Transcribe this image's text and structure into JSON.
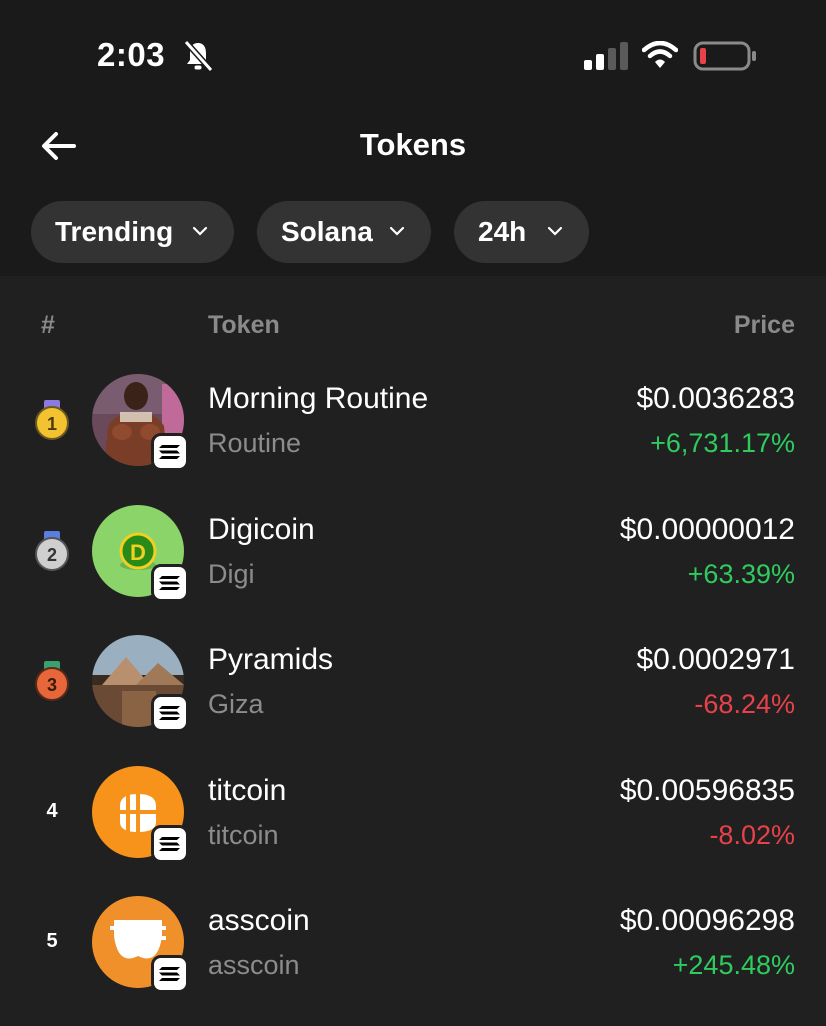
{
  "status_bar": {
    "time": "2:03"
  },
  "header": {
    "title": "Tokens"
  },
  "filters": [
    {
      "label": "Trending"
    },
    {
      "label": "Solana"
    },
    {
      "label": "24h"
    }
  ],
  "table": {
    "columns": {
      "rank": "#",
      "token": "Token",
      "price": "Price"
    },
    "rows": [
      {
        "rank": "1",
        "name": "Morning Routine",
        "symbol": "Routine",
        "price": "$0.0036283",
        "change": "+6,731.17%",
        "direction": "up",
        "avatar": "man-photo"
      },
      {
        "rank": "2",
        "name": "Digicoin",
        "symbol": "Digi",
        "price": "$0.00000012",
        "change": "+63.39%",
        "direction": "up",
        "avatar": "green-coin"
      },
      {
        "rank": "3",
        "name": "Pyramids",
        "symbol": "Giza",
        "price": "$0.0002971",
        "change": "-68.24%",
        "direction": "down",
        "avatar": "pyramids-photo"
      },
      {
        "rank": "4",
        "name": "titcoin",
        "symbol": "titcoin",
        "price": "$0.00596835",
        "change": "-8.02%",
        "direction": "down",
        "avatar": "orange-b-coin"
      },
      {
        "rank": "5",
        "name": "asscoin",
        "symbol": "asscoin",
        "price": "$0.00096298",
        "change": "+245.48%",
        "direction": "up",
        "avatar": "orange-underwear-coin"
      }
    ]
  },
  "colors": {
    "positive": "#2ecc5f",
    "negative": "#e8414a",
    "gold": "#f2c230",
    "silver": "#cfcfcf",
    "bronze": "#e8673a"
  }
}
